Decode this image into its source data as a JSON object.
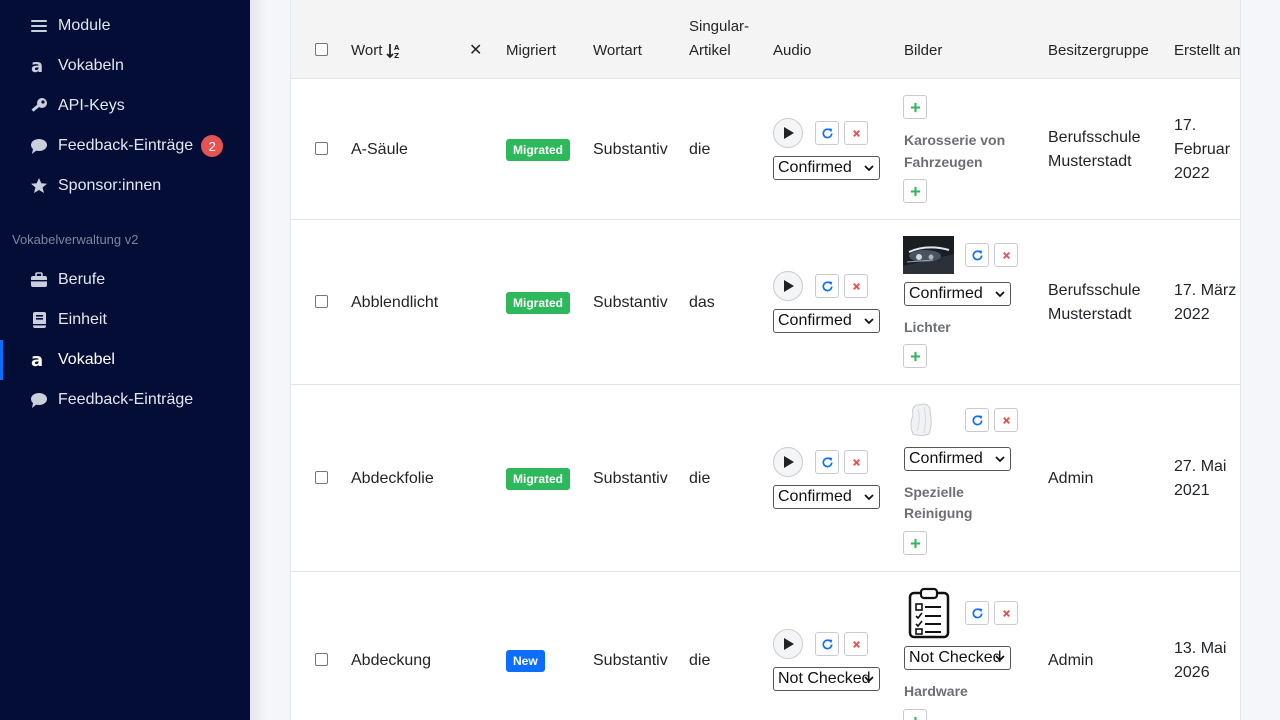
{
  "sidebar": {
    "top_items": [
      {
        "label": "Module",
        "icon": "menu-icon"
      },
      {
        "label": "Vokabeln",
        "icon": "letter-a-icon"
      },
      {
        "label": "API-Keys",
        "icon": "key-icon"
      },
      {
        "label": "Feedback-Einträge",
        "icon": "comment-icon",
        "badge": "2"
      },
      {
        "label": "Sponsor:innen",
        "icon": "star-icon"
      }
    ],
    "section_title": "Vokabelverwaltung v2",
    "section_items": [
      {
        "label": "Berufe",
        "icon": "briefcase-icon"
      },
      {
        "label": "Einheit",
        "icon": "book-icon"
      },
      {
        "label": "Vokabel",
        "icon": "letter-a-icon",
        "active": true
      },
      {
        "label": "Feedback-Einträge",
        "icon": "comment-icon"
      }
    ]
  },
  "table": {
    "headers": {
      "wort": "Wort",
      "clear": "✕",
      "migriert": "Migriert",
      "wortart": "Wortart",
      "artikel_line1": "Singular-",
      "artikel_line2": "Artikel",
      "audio": "Audio",
      "bilder": "Bilder",
      "besitzergruppe": "Besitzergruppe",
      "erstellt": "Erstellt am"
    },
    "rows": [
      {
        "wort": "A-Säule",
        "migriert": "Migrated",
        "migriert_color": "#2eb85c",
        "wortart": "Substantiv",
        "artikel": "die",
        "audio_status": "Confirmed",
        "has_image": false,
        "image_status": "",
        "category_line1": "Karosserie von",
        "category_line2": "Fahrzeugen",
        "besitzer_line1": "Berufsschule",
        "besitzer_line2": "Musterstadt",
        "date_line1": "17.",
        "date_line2": "Februar",
        "date_line3": "2022"
      },
      {
        "wort": "Abblendlicht",
        "migriert": "Migrated",
        "migriert_color": "#2eb85c",
        "wortart": "Substantiv",
        "artikel": "das",
        "audio_status": "Confirmed",
        "has_image": true,
        "image_status": "Confirmed",
        "category_line1": "Lichter",
        "category_line2": "",
        "besitzer_line1": "Berufsschule",
        "besitzer_line2": "Musterstadt",
        "date_line1": "17. März",
        "date_line2": "2022",
        "date_line3": ""
      },
      {
        "wort": "Abdeckfolie",
        "migriert": "Migrated",
        "migriert_color": "#2eb85c",
        "wortart": "Substantiv",
        "artikel": "die",
        "audio_status": "Confirmed",
        "has_image": true,
        "image_status": "Confirmed",
        "category_line1": "Spezielle",
        "category_line2": "Reinigung",
        "besitzer_line1": "Admin",
        "besitzer_line2": "",
        "date_line1": "27. Mai",
        "date_line2": "2021",
        "date_line3": ""
      },
      {
        "wort": "Abdeckung",
        "migriert": "New",
        "migriert_color": "#0d6efd",
        "wortart": "Substantiv",
        "artikel": "die",
        "audio_status": "Not Checked",
        "has_image": true,
        "image_status": "Not Checked",
        "category_line1": "Hardware",
        "category_line2": "",
        "besitzer_line1": "Admin",
        "besitzer_line2": "",
        "date_line1": "13. Mai",
        "date_line2": "2026",
        "date_line3": ""
      }
    ]
  },
  "colors": {
    "sidebar_bg": "#030d36",
    "accent": "#0d6efd",
    "success": "#2eb85c",
    "danger": "#e55353"
  }
}
